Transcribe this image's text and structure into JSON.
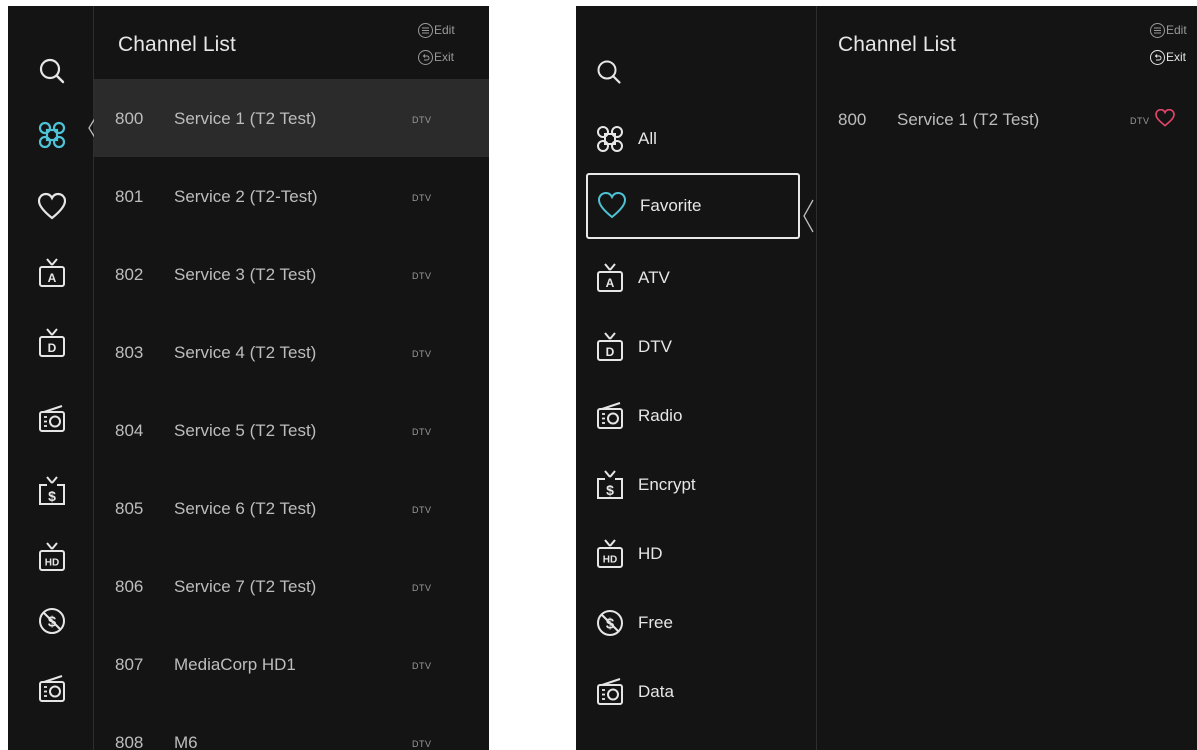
{
  "left_panel": {
    "title": "Channel List",
    "edit_label": "Edit",
    "exit_label": "Exit",
    "channels": [
      {
        "number": "800",
        "name": "Service 1 (T2 Test)",
        "type": "DTV"
      },
      {
        "number": "801",
        "name": "Service 2 (T2-Test)",
        "type": "DTV"
      },
      {
        "number": "802",
        "name": "Service 3 (T2 Test)",
        "type": "DTV"
      },
      {
        "number": "803",
        "name": "Service 4 (T2 Test)",
        "type": "DTV"
      },
      {
        "number": "804",
        "name": "Service 5 (T2 Test)",
        "type": "DTV"
      },
      {
        "number": "805",
        "name": "Service 6 (T2 Test)",
        "type": "DTV"
      },
      {
        "number": "806",
        "name": "Service 7 (T2 Test)",
        "type": "DTV"
      },
      {
        "number": "807",
        "name": "MediaCorp HD1",
        "type": "DTV"
      },
      {
        "number": "808",
        "name": "M6",
        "type": "DTV"
      }
    ],
    "rail_icons": [
      "search-icon",
      "all-icon",
      "favorite-icon",
      "atv-icon",
      "dtv-icon",
      "radio-icon",
      "encrypt-icon",
      "hd-icon",
      "free-icon",
      "data-icon"
    ]
  },
  "right_panel": {
    "title": "Channel List",
    "edit_label": "Edit",
    "exit_label": "Exit",
    "categories": [
      {
        "label": "All",
        "icon": "all-icon"
      },
      {
        "label": "Favorite",
        "icon": "favorite-icon"
      },
      {
        "label": "ATV",
        "icon": "atv-icon"
      },
      {
        "label": "DTV",
        "icon": "dtv-icon"
      },
      {
        "label": "Radio",
        "icon": "radio-icon"
      },
      {
        "label": "Encrypt",
        "icon": "encrypt-icon"
      },
      {
        "label": "HD",
        "icon": "hd-icon"
      },
      {
        "label": "Free",
        "icon": "free-icon"
      },
      {
        "label": "Data",
        "icon": "data-icon"
      }
    ],
    "channels": [
      {
        "number": "800",
        "name": "Service 1 (T2 Test)",
        "type": "DTV",
        "favorite": true
      }
    ]
  },
  "colors": {
    "background": "#141414",
    "accent": "#4ec3d6",
    "favorite": "#e2456b",
    "text": "#d7d7d7"
  }
}
